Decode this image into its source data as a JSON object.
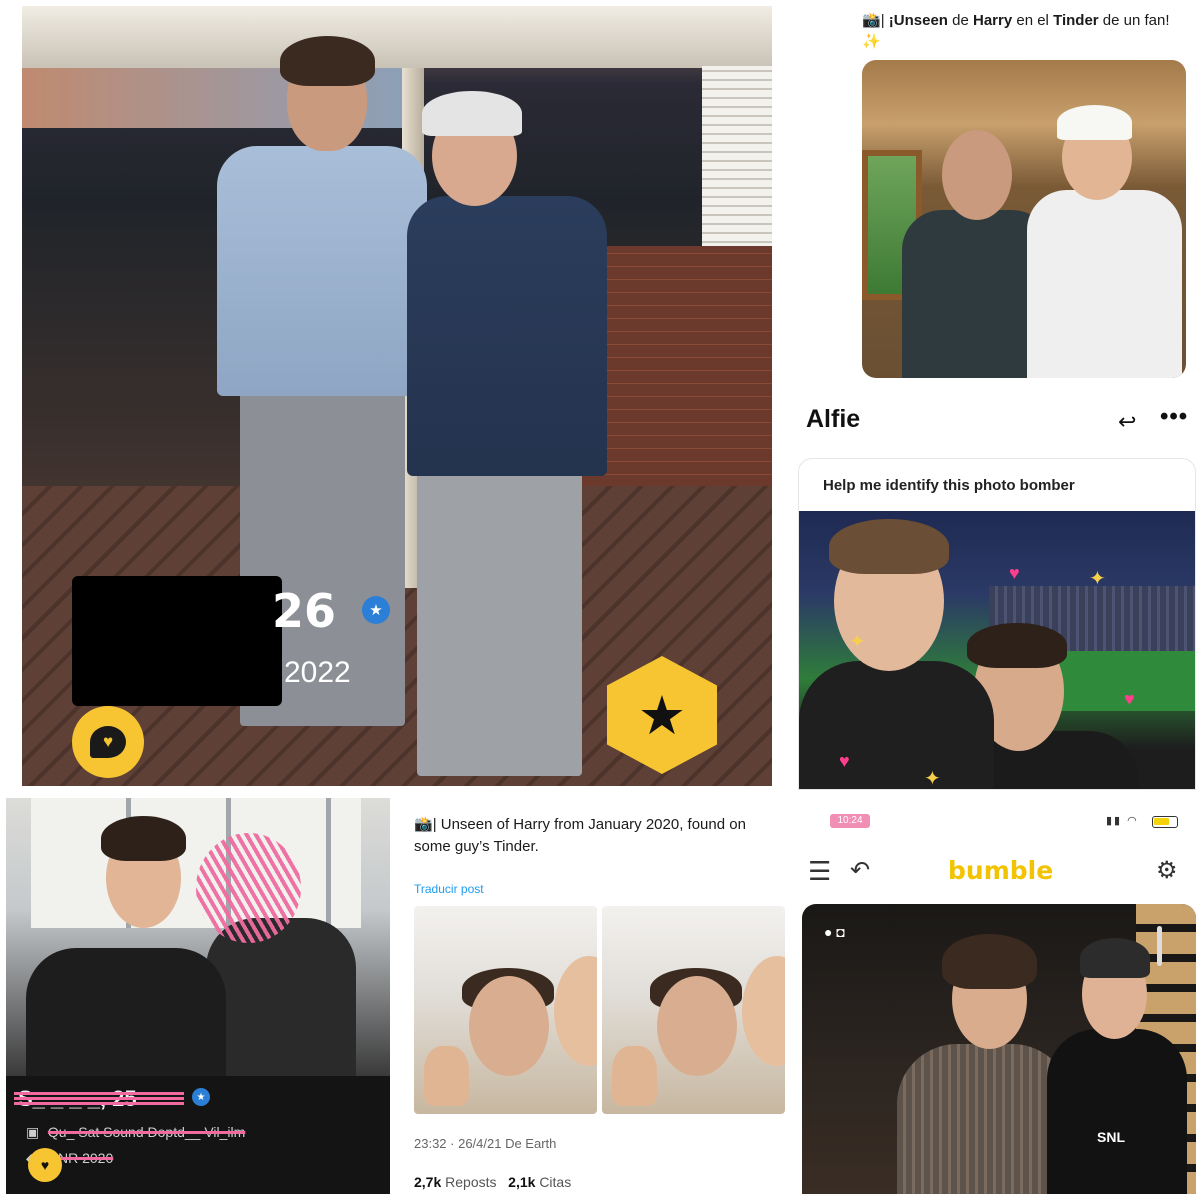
{
  "panel_tinder_golf": {
    "age": "26",
    "year": "2022",
    "verified_icon": "verified-badge-icon",
    "message_icon": "message-heart-icon",
    "superlike_icon": "star-icon"
  },
  "panel_tweet_top": {
    "emoji": "📸",
    "text_parts": [
      "| ",
      "¡Unseen",
      " de ",
      "Harry",
      " en el ",
      "Tinder",
      " de un fan! ",
      "✨"
    ]
  },
  "panel_alfie": {
    "name": "Alfie",
    "share_icon": "share-icon",
    "more_icon": "more-icon",
    "more_glyph": "•••",
    "card_title": "Help me identify this photo bomber"
  },
  "panel_tinder_dark": {
    "name": "S_ _ _ _, 25",
    "job": "Qu_ Sat Sound Doptd__ Vil_ilm",
    "school": "UNR 2020"
  },
  "panel_tweet_bottom": {
    "emoji": "📸",
    "text": "| Unseen of Harry from January 2020, found on some guy’s Tinder.",
    "translate": "Traducir post",
    "meta": "23:32 · 26/4/21 De Earth",
    "reposts_count": "2,7k",
    "reposts_label": "Reposts",
    "quotes_count": "2,1k",
    "quotes_label": "Citas"
  },
  "panel_bumble": {
    "time": "10:24",
    "logo": "bumble",
    "menu_glyph": "☰",
    "undo_glyph": "↶",
    "filter_glyph": "⚙",
    "snl_label": "SNL"
  },
  "colors": {
    "tinder_yellow": "#f7c531",
    "bumble_yellow": "#f1c300",
    "verified_blue": "#2b7fd6",
    "link_blue": "#1d9bf0",
    "scribble_pink": "#f06a9f"
  }
}
